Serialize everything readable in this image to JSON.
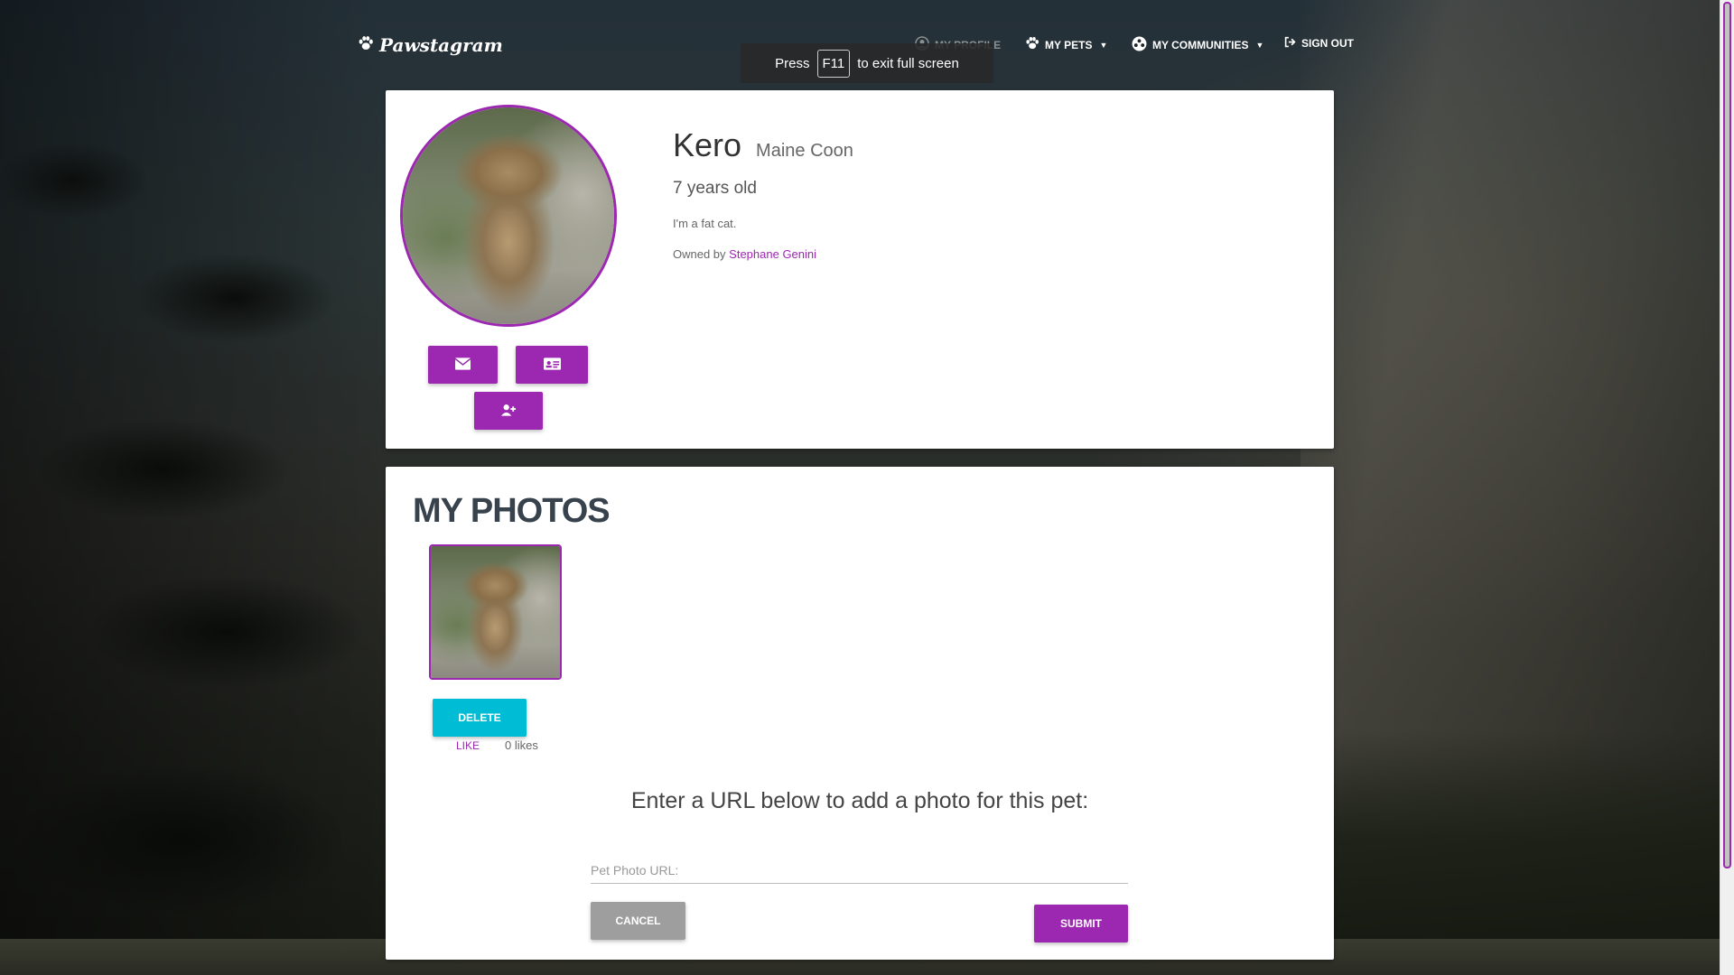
{
  "nav": {
    "brand": "Pawstagram",
    "my_profile": "MY PROFILE",
    "my_pets": "MY PETS",
    "my_communities": "MY COMMUNITIES",
    "sign_out": "SIGN OUT"
  },
  "fullscreen_notice": {
    "press": "Press",
    "key": "F11",
    "rest": "to exit full screen"
  },
  "profile": {
    "name": "Kero",
    "breed": "Maine Coon",
    "age": "7 years old",
    "description": "I'm a fat cat.",
    "owned_by_label": "Owned by",
    "owner": "Stephane Genini"
  },
  "photos": {
    "title": "MY PHOTOS",
    "delete_label": "DELETE",
    "like_label": "LIKE",
    "likes": "0 likes"
  },
  "add_photo": {
    "heading": "Enter a URL below to add a photo for this pet:",
    "placeholder": "Pet Photo URL:",
    "value": "",
    "cancel_label": "CANCEL",
    "submit_label": "SUBMIT"
  },
  "colors": {
    "accent": "#9c27b0",
    "delete": "#00bcd4",
    "cancel": "#9e9e9e"
  },
  "icons": {
    "brand": "paw-icon",
    "profile": "user-circle-icon",
    "pets": "paw-icon",
    "communities": "community-icon",
    "sign_out": "sign-out-icon",
    "message": "envelope-icon",
    "card": "id-card-icon",
    "follow": "user-plus-icon"
  }
}
